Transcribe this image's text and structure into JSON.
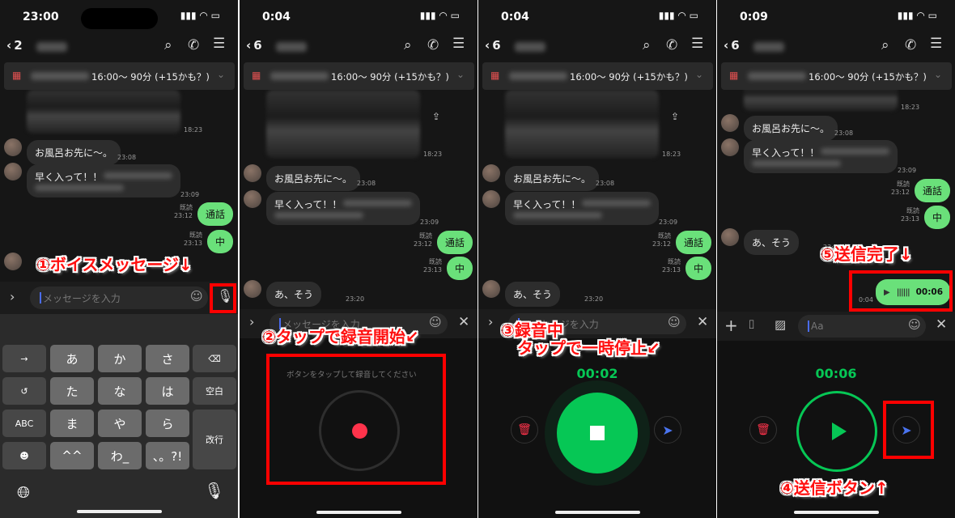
{
  "panels": [
    {
      "status_time": "23:00",
      "back_count": "2"
    },
    {
      "status_time": "0:04",
      "back_count": "6"
    },
    {
      "status_time": "0:04",
      "back_count": "6"
    },
    {
      "status_time": "0:09",
      "back_count": "6"
    }
  ],
  "chat": {
    "event_text": "16:00〜 90分 (+15かも？)",
    "image_time": "18:23",
    "messages": [
      {
        "text": "お風呂お先に〜。",
        "time": "23:08",
        "side": "in"
      },
      {
        "text": "早く入って！！",
        "time": "23:09",
        "side": "in"
      },
      {
        "text": "通話",
        "time": "23:12",
        "read": "既読",
        "side": "out"
      },
      {
        "text": "中",
        "time": "23:13",
        "read": "既読",
        "side": "out"
      },
      {
        "text": "あ、そう",
        "time": "23:20",
        "side": "in"
      }
    ],
    "voice_message": {
      "duration": "00:06",
      "time": "0:04"
    }
  },
  "input": {
    "placeholder": "メッセージを入力",
    "placeholder_short": "Aa"
  },
  "keyboard": {
    "keys": [
      "→",
      "あ",
      "か",
      "さ",
      "⌫",
      "↺",
      "た",
      "な",
      "は",
      "空白",
      "ABC",
      "ま",
      "や",
      "ら",
      "改行",
      "☻",
      "^^",
      "わ_",
      "、。?!"
    ]
  },
  "recorder": {
    "hint": "ボタンをタップして録音してください",
    "timer_recording": "00:02",
    "timer_stopped": "00:06"
  },
  "annotations": {
    "step1": "①ボイスメッセージ↓",
    "step2": "②タップで録音開始↙",
    "step3": "③録音中\n　タップで一時停止↙",
    "step4": "④送信ボタン↑",
    "step5": "⑤送信完了↓"
  },
  "colors": {
    "accent_green": "#06c755",
    "bubble_green": "#6ae07a",
    "record_red": "#ff334b",
    "send_blue": "#4a74f0",
    "annotation_red": "#ff1010"
  }
}
